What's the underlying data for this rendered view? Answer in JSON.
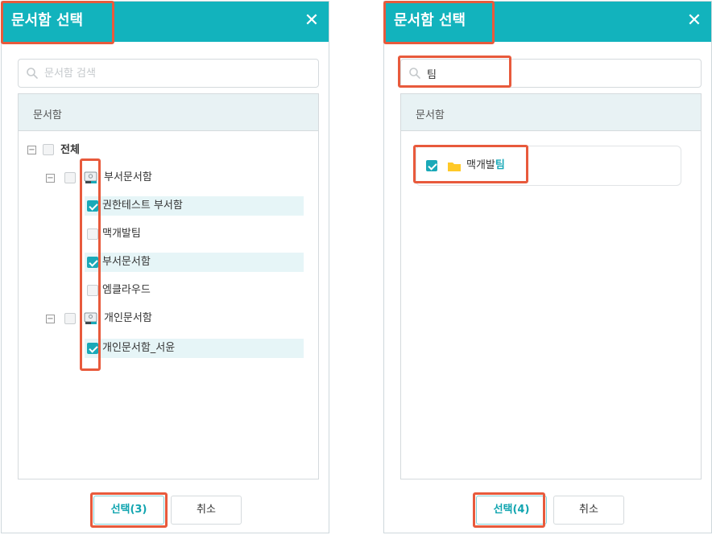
{
  "left": {
    "title": "문서함 선택",
    "close_glyph": "✕",
    "search_placeholder": "문서함 검색",
    "search_value": "",
    "panel_title": "문서함",
    "tree": {
      "root": {
        "label": "전체",
        "toggle": "−",
        "checked": false
      },
      "dept_group": {
        "label": "부서문서함",
        "toggle": "−",
        "checked": false,
        "icon": "department-folder-icon"
      },
      "dept_items": [
        {
          "label": "권한테스트 부서함",
          "checked": true
        },
        {
          "label": "맥개발팀",
          "checked": false
        },
        {
          "label": "부서문서함",
          "checked": true
        },
        {
          "label": "엠클라우드",
          "checked": false
        }
      ],
      "personal_group": {
        "label": "개인문서함",
        "toggle": "−",
        "checked": false,
        "icon": "personal-folder-icon"
      },
      "personal_items": [
        {
          "label": "개인문서함_서윤",
          "checked": true
        }
      ]
    },
    "select_button": "선택(3)",
    "cancel_button": "취소"
  },
  "right": {
    "title": "문서함 선택",
    "close_glyph": "✕",
    "search_value": "팀",
    "panel_title": "문서함",
    "result": {
      "label_prefix": "맥개발",
      "label_match": "팀",
      "checked": true,
      "icon": "folder-icon"
    },
    "select_button": "선택(4)",
    "cancel_button": "취소"
  },
  "colors": {
    "header": "#12b3bd",
    "accent": "#1aa9b8",
    "highlight_box": "#e85a3c",
    "selected_row": "#e6f5f7"
  }
}
